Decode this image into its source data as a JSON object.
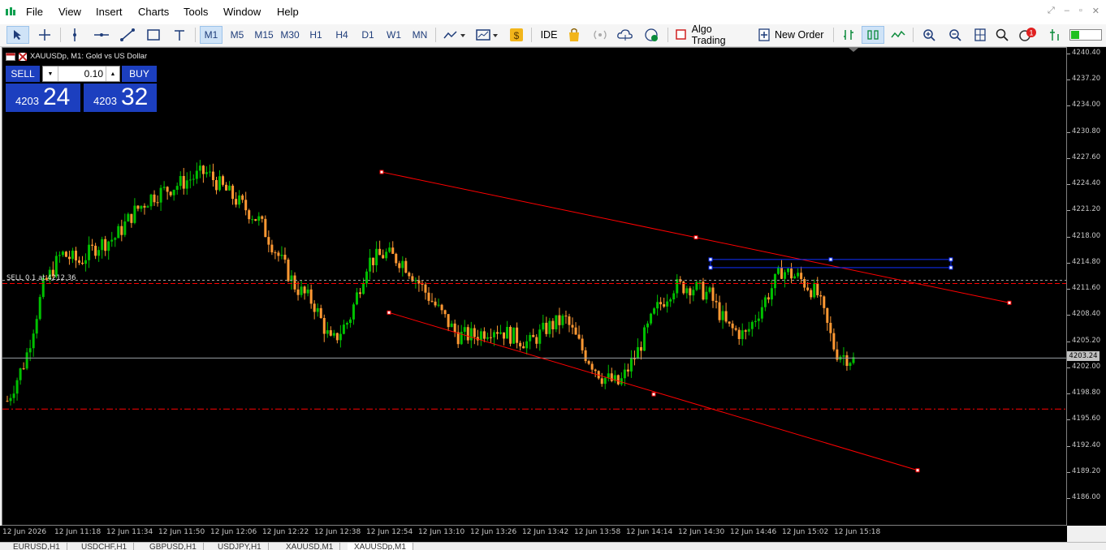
{
  "menu": {
    "items": [
      "File",
      "View",
      "Insert",
      "Charts",
      "Tools",
      "Window",
      "Help"
    ]
  },
  "toolbar": {
    "timeframes": [
      "M1",
      "M5",
      "M15",
      "M30",
      "H1",
      "H4",
      "D1",
      "W1",
      "MN"
    ],
    "active_timeframe": "M1",
    "ide_label": "IDE",
    "algo_trading_label": "Algo Trading",
    "new_order_label": "New Order",
    "notification_count": "1"
  },
  "chart": {
    "title": "XAUUSDp, M1:  Gold vs US Dollar",
    "sell_label": "SELL",
    "buy_label": "BUY",
    "lot": "0.10",
    "sell_price_prefix": "4203",
    "sell_price_main": "24",
    "buy_price_prefix": "4203",
    "buy_price_main": "32",
    "order_label": "SELL 0.1 at 4212.36",
    "bid_price": "4203.24",
    "colors": {
      "background": "#000000",
      "bull": "#00c000",
      "bear": "#ff9933",
      "trendline": "#ff0000",
      "rect": "#1030ff"
    }
  },
  "chart_data": {
    "type": "candlestick",
    "symbol": "XAUUSDp",
    "timeframe": "M1",
    "y_ticks": [
      "4240.40",
      "4237.20",
      "4234.00",
      "4230.80",
      "4227.60",
      "4224.40",
      "4221.20",
      "4218.00",
      "4214.80",
      "4211.60",
      "4208.40",
      "4205.20",
      "4202.00",
      "4198.80",
      "4195.60",
      "4192.40",
      "4189.20",
      "4186.00"
    ],
    "x_ticks": [
      "12 Jun 2026",
      "12 Jun 11:18",
      "12 Jun 11:34",
      "12 Jun 11:50",
      "12 Jun 12:06",
      "12 Jun 12:22",
      "12 Jun 12:38",
      "12 Jun 12:54",
      "12 Jun 13:10",
      "12 Jun 13:26",
      "12 Jun 13:42",
      "12 Jun 13:58",
      "12 Jun 14:14",
      "12 Jun 14:30",
      "12 Jun 14:46",
      "12 Jun 15:02",
      "12 Jun 15:18"
    ],
    "close_path": [
      4198,
      4203,
      4212,
      4216,
      4215,
      4217,
      4218,
      4221,
      4223,
      4224,
      4225,
      4226,
      4224,
      4222,
      4220,
      4216,
      4212,
      4210,
      4205,
      4208,
      4215,
      4216,
      4215,
      4212,
      4209,
      4206,
      4206,
      4207,
      4206,
      4205,
      4207,
      4208,
      4204,
      4201,
      4200,
      4204,
      4209,
      4212,
      4212,
      4211,
      4207,
      4206,
      4210,
      4214,
      4213,
      4211,
      4204,
      4203
    ],
    "bid": 4203.24,
    "order_price": 4212.36,
    "support_level": 4197.0
  },
  "tabs": [
    "EURUSD,H1",
    "USDCHF,H1",
    "GBPUSD,H1",
    "USDJPY,H1",
    "XAUUSD,M1",
    "XAUUSDp,M1"
  ],
  "active_tab": "XAUUSDp,M1"
}
